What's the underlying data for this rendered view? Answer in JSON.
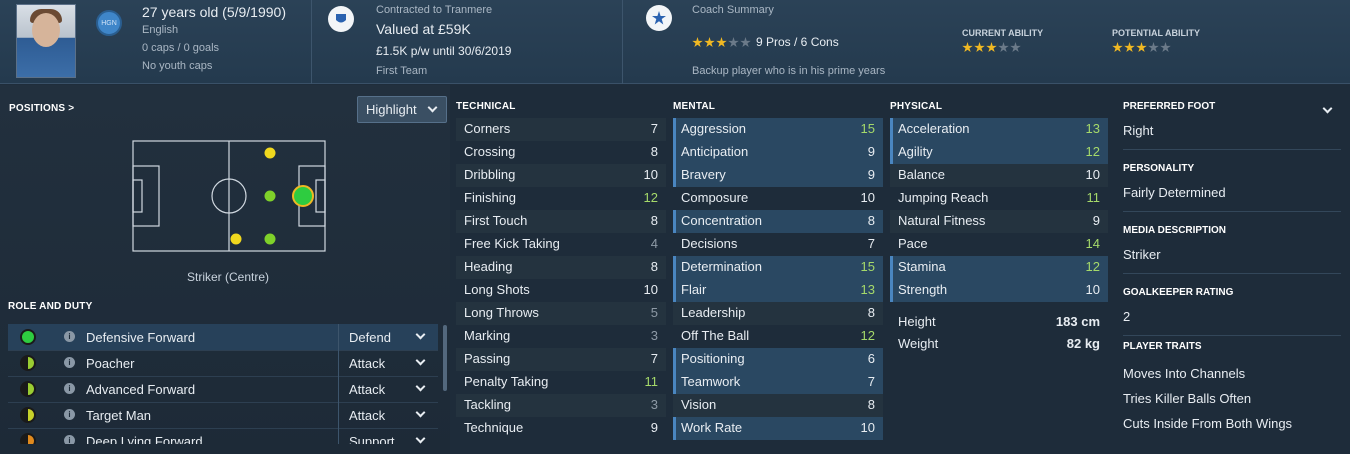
{
  "header": {
    "age": "27 years old (5/9/1990)",
    "nationality": "English",
    "caps": "0 caps / 0 goals",
    "youth_caps": "No youth caps",
    "nation_badge": "HGN",
    "contract_line": "Contracted to Tranmere",
    "value": "Valued at £59K",
    "wage": "£1.5K p/w until 30/6/2019",
    "squad": "First Team",
    "coach_title": "Coach Summary",
    "coach_stars": 3,
    "pros_cons": "9 Pros / 6 Cons",
    "coach_desc": "Backup player who is in his prime years",
    "current_ability_label": "CURRENT ABILITY",
    "current_ability_stars": 3,
    "potential_ability_label": "POTENTIAL ABILITY",
    "potential_ability_stars": 3
  },
  "positions": {
    "title": "POSITIONS",
    "chevron": ">",
    "dropdown": "Highlight",
    "position_name": "Striker (Centre)"
  },
  "role": {
    "title": "ROLE AND DUTY",
    "rows": [
      {
        "name": "Defensive Forward",
        "duty": "Defend",
        "color": "#2ecc40"
      },
      {
        "name": "Poacher",
        "duty": "Attack",
        "color": "#9acd32"
      },
      {
        "name": "Advanced Forward",
        "duty": "Attack",
        "color": "#9acd32"
      },
      {
        "name": "Target Man",
        "duty": "Attack",
        "color": "#c7d12a"
      },
      {
        "name": "Deep Lying Forward",
        "duty": "Support",
        "color": "#e08a1e"
      }
    ]
  },
  "technical": {
    "title": "TECHNICAL",
    "rows": [
      {
        "name": "Corners",
        "value": "7"
      },
      {
        "name": "Crossing",
        "value": "8"
      },
      {
        "name": "Dribbling",
        "value": "10"
      },
      {
        "name": "Finishing",
        "value": "12"
      },
      {
        "name": "First Touch",
        "value": "8"
      },
      {
        "name": "Free Kick Taking",
        "value": "4"
      },
      {
        "name": "Heading",
        "value": "8"
      },
      {
        "name": "Long Shots",
        "value": "10"
      },
      {
        "name": "Long Throws",
        "value": "5"
      },
      {
        "name": "Marking",
        "value": "3"
      },
      {
        "name": "Passing",
        "value": "7"
      },
      {
        "name": "Penalty Taking",
        "value": "11"
      },
      {
        "name": "Tackling",
        "value": "3"
      },
      {
        "name": "Technique",
        "value": "9"
      }
    ]
  },
  "mental": {
    "title": "MENTAL",
    "rows": [
      {
        "name": "Aggression",
        "value": "15"
      },
      {
        "name": "Anticipation",
        "value": "9"
      },
      {
        "name": "Bravery",
        "value": "9"
      },
      {
        "name": "Composure",
        "value": "10"
      },
      {
        "name": "Concentration",
        "value": "8"
      },
      {
        "name": "Decisions",
        "value": "7"
      },
      {
        "name": "Determination",
        "value": "15"
      },
      {
        "name": "Flair",
        "value": "13"
      },
      {
        "name": "Leadership",
        "value": "8"
      },
      {
        "name": "Off The Ball",
        "value": "12"
      },
      {
        "name": "Positioning",
        "value": "6"
      },
      {
        "name": "Teamwork",
        "value": "7"
      },
      {
        "name": "Vision",
        "value": "8"
      },
      {
        "name": "Work Rate",
        "value": "10"
      }
    ]
  },
  "physical": {
    "title": "PHYSICAL",
    "rows": [
      {
        "name": "Acceleration",
        "value": "13"
      },
      {
        "name": "Agility",
        "value": "12"
      },
      {
        "name": "Balance",
        "value": "10"
      },
      {
        "name": "Jumping Reach",
        "value": "11"
      },
      {
        "name": "Natural Fitness",
        "value": "9"
      },
      {
        "name": "Pace",
        "value": "14"
      },
      {
        "name": "Stamina",
        "value": "12"
      },
      {
        "name": "Strength",
        "value": "10"
      }
    ],
    "height_label": "Height",
    "height": "183 cm",
    "weight_label": "Weight",
    "weight": "82 kg"
  },
  "info": {
    "foot_label": "PREFERRED FOOT",
    "foot": "Right",
    "personality_label": "PERSONALITY",
    "personality": "Fairly Determined",
    "media_label": "MEDIA DESCRIPTION",
    "media": "Striker",
    "gk_label": "GOALKEEPER RATING",
    "gk": "2",
    "traits_label": "PLAYER TRAITS",
    "traits": [
      "Moves Into Channels",
      "Tries Killer Balls Often",
      "Cuts Inside From Both Wings"
    ]
  },
  "colors": {
    "accent": "#4a86c0",
    "good_value": "#a5d96a",
    "star": "#f0b823"
  }
}
